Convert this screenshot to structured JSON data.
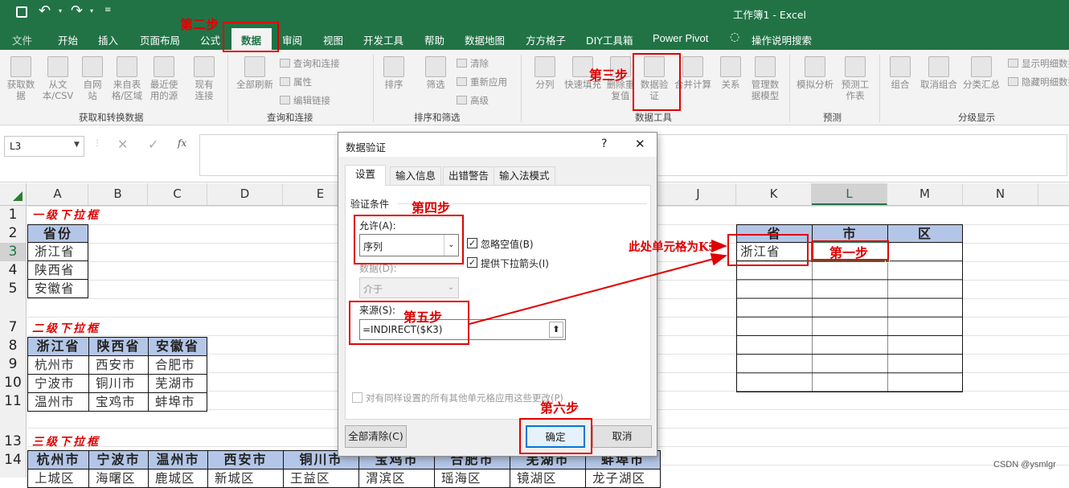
{
  "window": {
    "title": "工作簿1 - Excel"
  },
  "tabs": [
    "文件",
    "开始",
    "插入",
    "页面布局",
    "公式",
    "数据",
    "审阅",
    "视图",
    "开发工具",
    "帮助",
    "数据地图",
    "方方格子",
    "DIY工具箱",
    "Power Pivot",
    "操作说明搜索"
  ],
  "ribbon": {
    "get_transform": {
      "btn1": "获取数据",
      "btn2": "从文本/CSV",
      "btn3": "自网站",
      "btn4": "来自表格/区域",
      "btn5": "最近使用的源",
      "btn6": "现有连接",
      "label": "获取和转换数据"
    },
    "queries": {
      "refresh": "全部刷新",
      "queries_connections": "查询和连接",
      "properties": "属性",
      "edit_links": "编辑链接",
      "label": "查询和连接"
    },
    "sort_filter": {
      "sort": "排序",
      "filter": "筛选",
      "clear": "清除",
      "reapply": "重新应用",
      "advanced": "高级",
      "label": "排序和筛选"
    },
    "data_tools": {
      "split": "分列",
      "flash_fill": "快速填充",
      "remove_dup": "删除重复值",
      "validation": "数据验证",
      "consolidate": "合并计算",
      "relations": "关系",
      "model": "管理数据模型",
      "label": "数据工具"
    },
    "forecast": {
      "whatif": "模拟分析",
      "sheet": "预测工作表",
      "label": "预测"
    },
    "outline": {
      "group": "组合",
      "ungroup": "取消组合",
      "subtotal": "分类汇总",
      "show_detail": "显示明细数据",
      "hide_detail": "隐藏明细数据",
      "label": "分级显示"
    }
  },
  "formula_bar": {
    "name_box": "L3",
    "fx": "fx"
  },
  "columns": [
    "A",
    "B",
    "C",
    "D",
    "E",
    "J",
    "K",
    "L",
    "M",
    "N"
  ],
  "rows": [
    "1",
    "2",
    "3",
    "4",
    "5",
    "7",
    "8",
    "9",
    "10",
    "11",
    "13",
    "14"
  ],
  "sheet": {
    "title1": "一级下拉框",
    "province_header": "省份",
    "provinces": [
      "浙江省",
      "陕西省",
      "安徽省"
    ],
    "title2": "二级下拉框",
    "level2_headers": [
      "浙江省",
      "陕西省",
      "安徽省"
    ],
    "level2_rows": [
      [
        "杭州市",
        "西安市",
        "合肥市"
      ],
      [
        "宁波市",
        "铜川市",
        "芜湖市"
      ],
      [
        "温州市",
        "宝鸡市",
        "蚌埠市"
      ]
    ],
    "title3": "三级下拉框",
    "level3_headers": [
      "杭州市",
      "宁波市",
      "温州市",
      "西安市",
      "铜川市",
      "宝鸡市",
      "合肥市",
      "芜湖市",
      "蚌埠市"
    ],
    "level3_row": [
      "上城区",
      "海曙区",
      "鹿城区",
      "新城区",
      "王益区",
      "渭滨区",
      "瑶海区",
      "镜湖区",
      "龙子湖区"
    ],
    "right_headers": [
      "省",
      "市",
      "区"
    ],
    "k3": "浙江省"
  },
  "dialog": {
    "title": "数据验证",
    "help": "?",
    "close": "✕",
    "tabs": [
      "设置",
      "输入信息",
      "出错警告",
      "输入法模式"
    ],
    "criteria_label": "验证条件",
    "allow_label": "允许(A):",
    "allow_value": "序列",
    "ignore_blank": "忽略空值(B)",
    "dropdown": "提供下拉箭头(I)",
    "data_label": "数据(D):",
    "data_value": "介于",
    "source_label": "来源(S):",
    "source_value": "=INDIRECT($K3)",
    "apply_all": "对有同样设置的所有其他单元格应用这些更改(P)",
    "clear_all": "全部清除(C)",
    "ok": "确定",
    "cancel": "取消"
  },
  "annotations": {
    "step1": "第一步",
    "step2": "第二步",
    "step3": "第三步",
    "step4": "第四步",
    "step5": "第五步",
    "step6": "第六步",
    "k3_note": "此处单元格为K3"
  },
  "watermark": "CSDN @ysmlgr",
  "colors": {
    "excel_green": "#217346",
    "header_blue": "#b4c6e7",
    "annotation_red": "#e00000"
  }
}
